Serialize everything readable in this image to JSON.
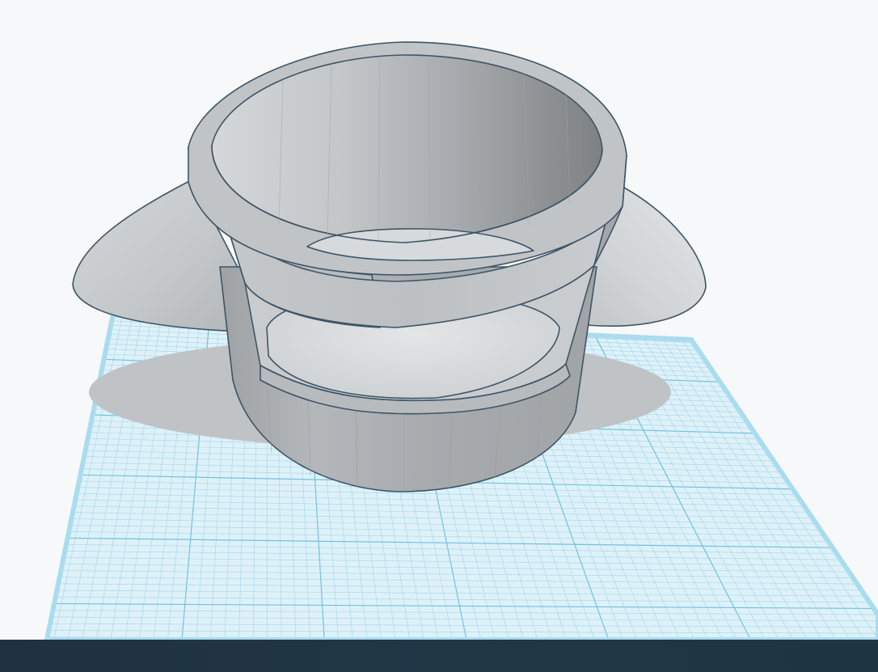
{
  "app": {
    "view": "3d-workplane",
    "colors": {
      "background": "#f7f8f9",
      "workplane_fill": "#dff1f8",
      "grid_minor": "#9ed6ea",
      "grid_major": "#6fc2e0",
      "grid_edge": "#a9dcef",
      "model_light": "#d9dcde",
      "model_mid": "#b4b8bb",
      "model_dark": "#8e9294",
      "model_edge": "#3e5566",
      "shadow": "#bfc3c6",
      "bottom_bar": "#1f3442"
    }
  },
  "workplane": {
    "grid_visible": true
  },
  "model": {
    "shape": "cup-with-side-fins",
    "has_window_cutout": true
  },
  "bottom_bar": {}
}
